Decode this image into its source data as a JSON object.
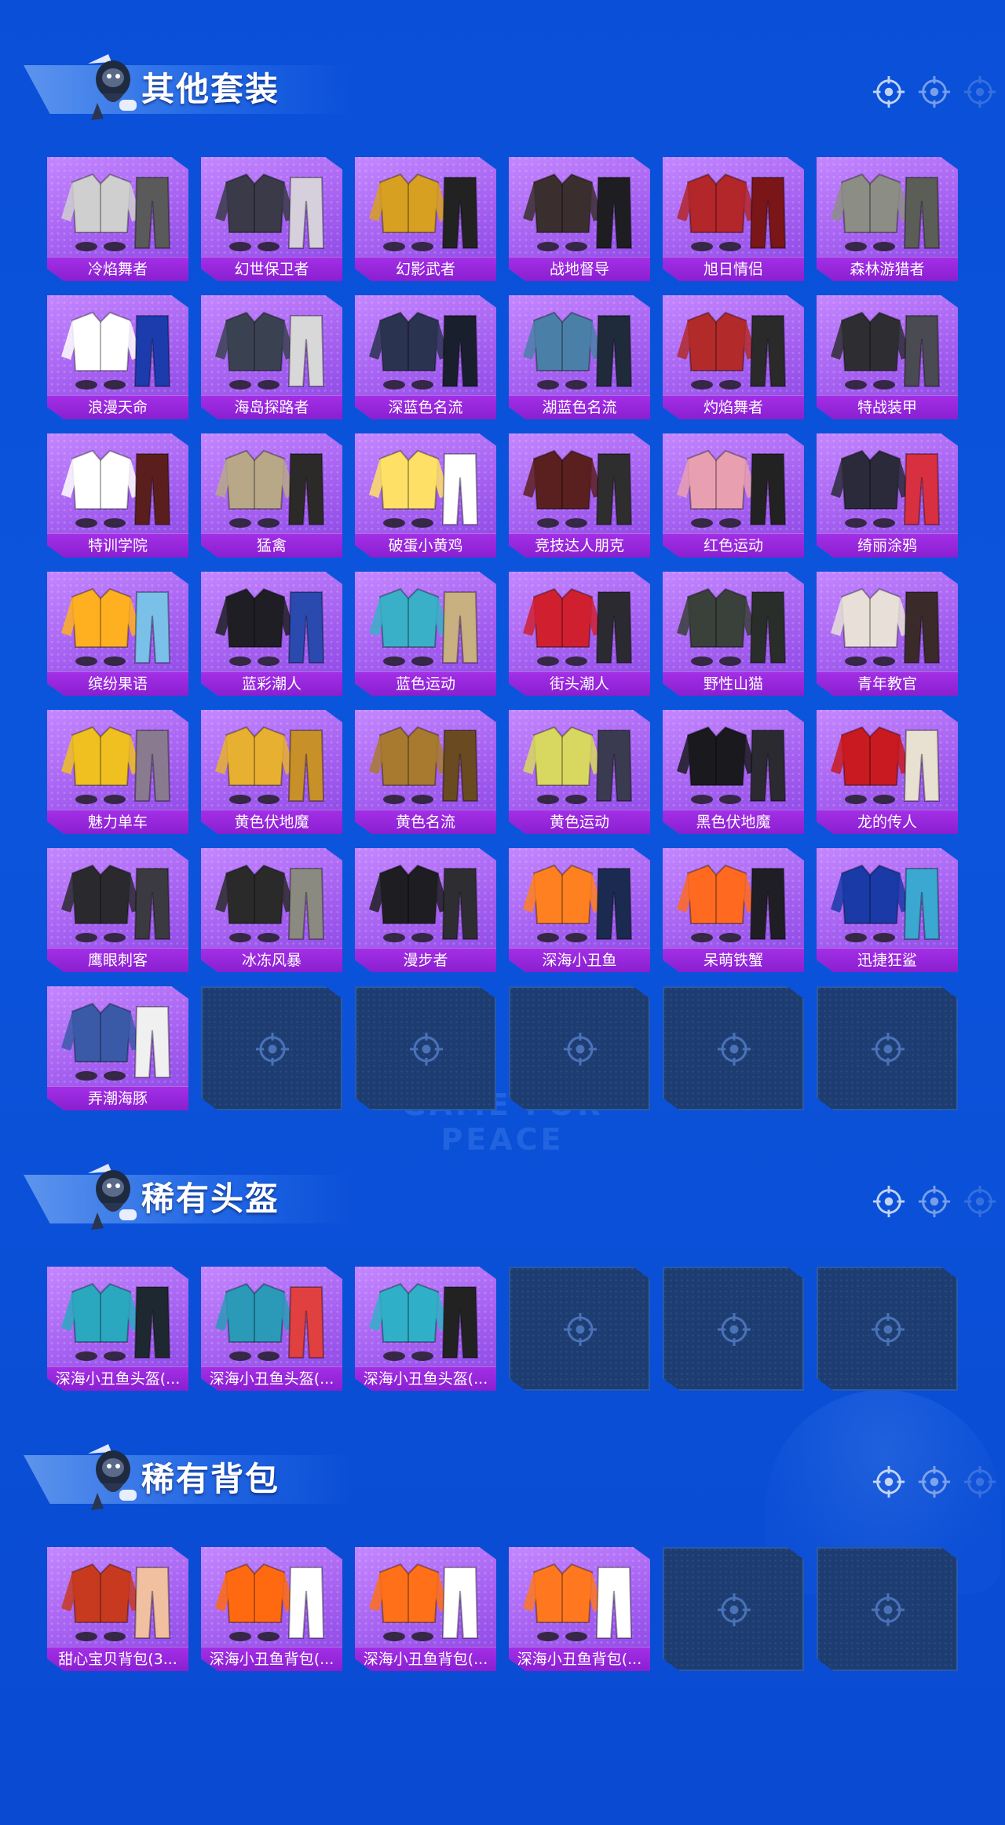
{
  "watermark": "GAME FOR PEACE",
  "sections": [
    {
      "title": "其他套装",
      "items": [
        {
          "label": "冷焰舞者",
          "c1": "#cfcfcf",
          "c2": "#5a5a5a"
        },
        {
          "label": "幻世保卫者",
          "c1": "#3a3a48",
          "c2": "#d6d0dc"
        },
        {
          "label": "幻影武者",
          "c1": "#d8a020",
          "c2": "#222222"
        },
        {
          "label": "战地督导",
          "c1": "#3a2f2e",
          "c2": "#1e1e22"
        },
        {
          "label": "旭日情侣",
          "c1": "#b3262a",
          "c2": "#7a1518"
        },
        {
          "label": "森林游猎者",
          "c1": "#8c8e86",
          "c2": "#5b5d57"
        },
        {
          "label": "浪漫天命",
          "c1": "#ffffff",
          "c2": "#1c3cae"
        },
        {
          "label": "海岛探路者",
          "c1": "#3a4252",
          "c2": "#d8d8d8"
        },
        {
          "label": "深蓝色名流",
          "c1": "#2a3350",
          "c2": "#1a1f2e"
        },
        {
          "label": "湖蓝色名流",
          "c1": "#4a7fa8",
          "c2": "#1f2a3a"
        },
        {
          "label": "灼焰舞者",
          "c1": "#b32a2a",
          "c2": "#2a2a2a"
        },
        {
          "label": "特战装甲",
          "c1": "#2e2e32",
          "c2": "#4a4a52"
        },
        {
          "label": "特训学院",
          "c1": "#ffffff",
          "c2": "#5a1f1c"
        },
        {
          "label": "猛禽",
          "c1": "#b8a888",
          "c2": "#2c2a28"
        },
        {
          "label": "破蛋小黄鸡",
          "c1": "#ffe066",
          "c2": "#ffffff"
        },
        {
          "label": "竞技达人朋克",
          "c1": "#5a1f1f",
          "c2": "#2e2e2e"
        },
        {
          "label": "红色运动",
          "c1": "#e8a0b0",
          "c2": "#222222"
        },
        {
          "label": "绮丽涂鸦",
          "c1": "#2a2a3a",
          "c2": "#d83040"
        },
        {
          "label": "缤纷果语",
          "c1": "#ffb020",
          "c2": "#7ac0e8"
        },
        {
          "label": "蓝彩潮人",
          "c1": "#1e1e24",
          "c2": "#2a4ab0"
        },
        {
          "label": "蓝色运动",
          "c1": "#3ab0c8",
          "c2": "#c8b080"
        },
        {
          "label": "街头潮人",
          "c1": "#d02030",
          "c2": "#2a2a30"
        },
        {
          "label": "野性山猫",
          "c1": "#3a403a",
          "c2": "#2a2e2a"
        },
        {
          "label": "青年教官",
          "c1": "#e8e0d8",
          "c2": "#3a2a2a"
        },
        {
          "label": "魅力单车",
          "c1": "#f0c020",
          "c2": "#8a7a90"
        },
        {
          "label": "黄色伏地魔",
          "c1": "#e8b030",
          "c2": "#c89028"
        },
        {
          "label": "黄色名流",
          "c1": "#a87a30",
          "c2": "#6a4a20"
        },
        {
          "label": "黄色运动",
          "c1": "#d8d860",
          "c2": "#3a3a50"
        },
        {
          "label": "黑色伏地魔",
          "c1": "#1a1a1e",
          "c2": "#2a2a30"
        },
        {
          "label": "龙的传人",
          "c1": "#c81a20",
          "c2": "#e8e0d0"
        },
        {
          "label": "鹰眼刺客",
          "c1": "#2a2a2e",
          "c2": "#3a3a40"
        },
        {
          "label": "冰冻风暴",
          "c1": "#2a2a2a",
          "c2": "#8a8a80"
        },
        {
          "label": "漫步者",
          "c1": "#1e1e22",
          "c2": "#2e2e32"
        },
        {
          "label": "深海小丑鱼",
          "c1": "#ff8020",
          "c2": "#1a2a50"
        },
        {
          "label": "呆萌铁蟹",
          "c1": "#ff6a20",
          "c2": "#1e1e24"
        },
        {
          "label": "迅捷狂鲨",
          "c1": "#1a3aa8",
          "c2": "#3aa8d0"
        },
        {
          "label": "弄潮海豚",
          "c1": "#3a5aa8",
          "c2": "#f0f0f0"
        }
      ],
      "empty_count": 5
    },
    {
      "title": "稀有头盔",
      "items": [
        {
          "label": "深海小丑鱼头盔(...",
          "c1": "#2aa8c0",
          "c2": "#1e2830"
        },
        {
          "label": "深海小丑鱼头盔(...",
          "c1": "#2a9ab8",
          "c2": "#e04040"
        },
        {
          "label": "深海小丑鱼头盔(...",
          "c1": "#30b0c8",
          "c2": "#222222"
        }
      ],
      "empty_count": 3
    },
    {
      "title": "稀有背包",
      "items": [
        {
          "label": "甜心宝贝背包(3...",
          "c1": "#c83a20",
          "c2": "#f0c0a0"
        },
        {
          "label": "深海小丑鱼背包(...",
          "c1": "#ff6a10",
          "c2": "#ffffff"
        },
        {
          "label": "深海小丑鱼背包(...",
          "c1": "#ff7018",
          "c2": "#ffffff"
        },
        {
          "label": "深海小丑鱼背包(...",
          "c1": "#ff7820",
          "c2": "#ffffff"
        }
      ],
      "empty_count": 2
    }
  ]
}
